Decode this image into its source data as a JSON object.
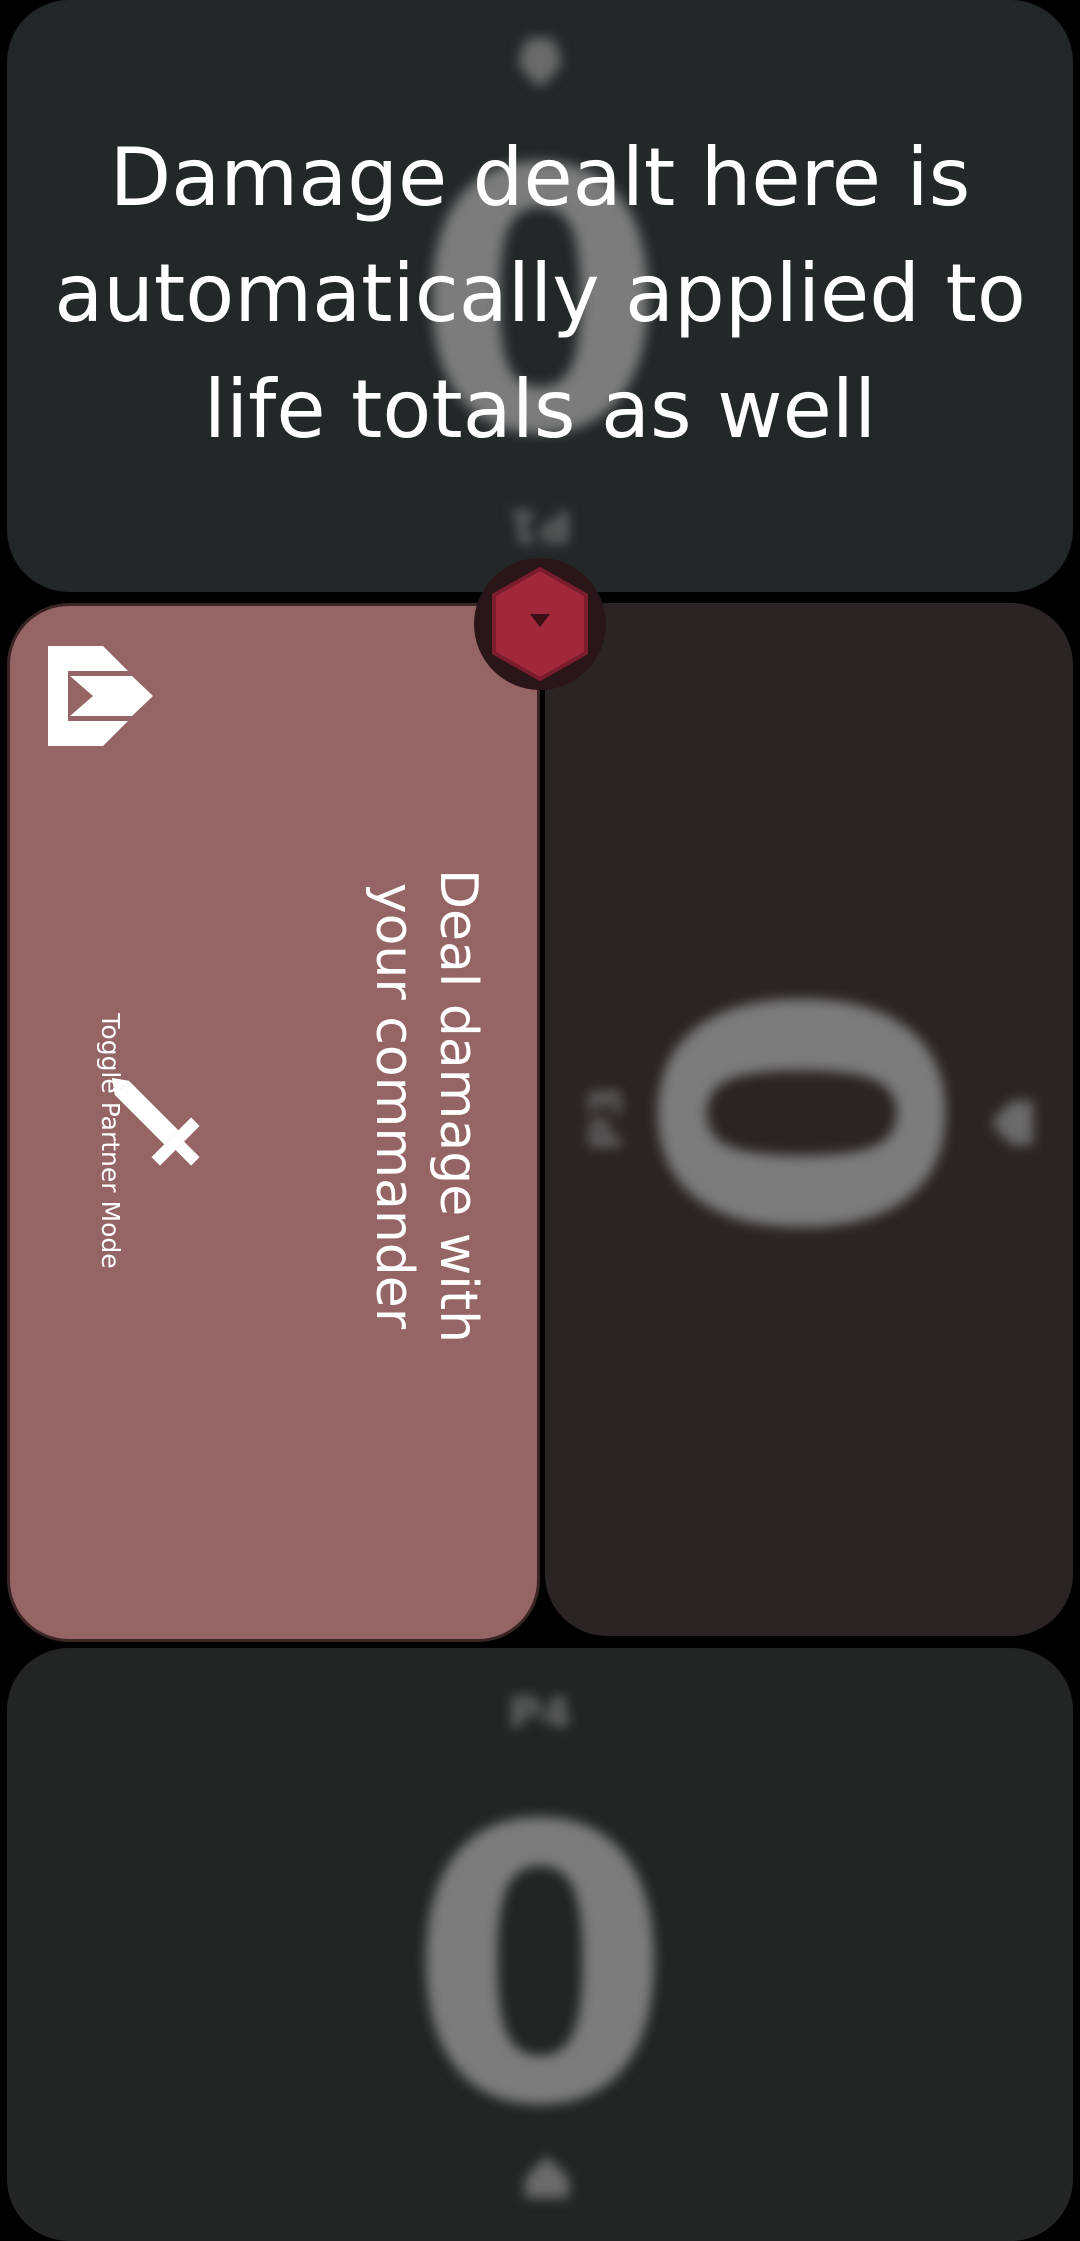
{
  "top_panel": {
    "player_label": "P1",
    "damage_value": "0",
    "tip": "Damage dealt here is automatically applied to life totals as well"
  },
  "left_panel": {
    "instruction": "Deal damage with your commander",
    "toggle_label": "Toggle Partner Mode"
  },
  "right_panel": {
    "player_label": "P3",
    "damage_value": "0"
  },
  "bottom_panel": {
    "player_label": "P4",
    "damage_value": "0"
  },
  "icons": {
    "partner": "partner-mode-icon",
    "sword": "sword-icon",
    "center": "hexagon-menu-icon",
    "player": "player-icon"
  },
  "colors": {
    "active_panel": "#956565",
    "center_button": "#a0283a"
  }
}
